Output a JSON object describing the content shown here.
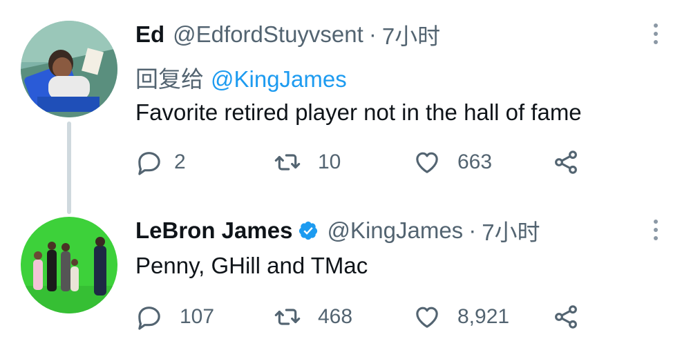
{
  "tweets": [
    {
      "name": "Ed",
      "handle": "@EdfordStuyvsent",
      "separator": "·",
      "time": "7小时",
      "reply_prefix": "回复给",
      "reply_mention": "@KingJames",
      "text": "Favorite retired player not in the hall of fame",
      "replies": "2",
      "retweets": "10",
      "likes": "663",
      "verified": false
    },
    {
      "name": "LeBron James",
      "handle": "@KingJames",
      "separator": "·",
      "time": "7小时",
      "text": "Penny, GHill and TMac",
      "replies": "107",
      "retweets": "468",
      "likes": "8,921",
      "verified": true
    }
  ],
  "colors": {
    "verified_badge": "#1d9bf0",
    "secondary_text": "#536471",
    "thread_line": "#cfd9de",
    "mention": "#1d9bf0"
  },
  "icons": {
    "reply": "speech-bubble-icon",
    "retweet": "retweet-icon",
    "like": "heart-icon",
    "share": "share-icon",
    "more": "vertical-dots-icon"
  }
}
